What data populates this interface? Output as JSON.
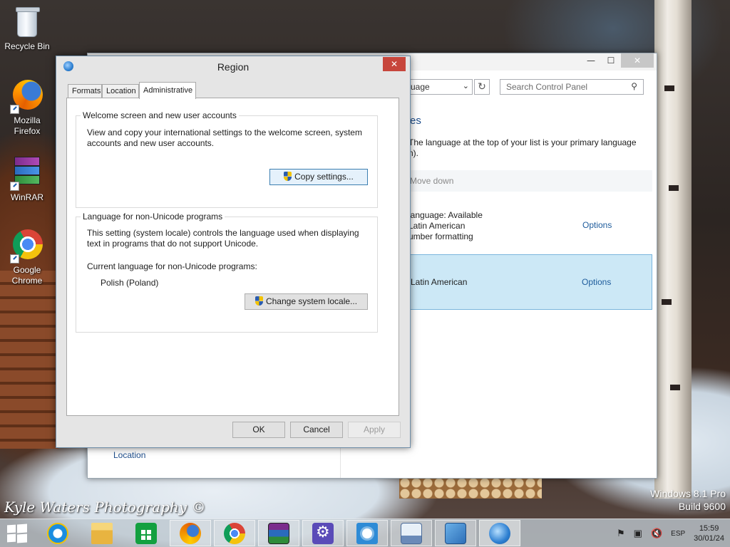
{
  "desktop": {
    "icons": [
      {
        "label": "Recycle Bin"
      },
      {
        "label": "Mozilla Firefox"
      },
      {
        "label": "WinRAR"
      },
      {
        "label": "Google Chrome"
      }
    ],
    "watermark": "Kyle Waters Photography ©",
    "os_edition": "Windows 8.1 Pro",
    "os_build": "Build 9600"
  },
  "control_panel": {
    "dropdown_value": "uage",
    "search_placeholder": "Search Control Panel",
    "heading_fragment": "es",
    "description": "The language at the top of your list is your primary language",
    "description_tail": "n).",
    "toolbar_move_down": "Move down",
    "languages": [
      {
        "line1": "language: Available",
        "line2": "Latin American",
        "line3": "umber formatting",
        "options_label": "Options"
      },
      {
        "name": "Latin American",
        "options_label": "Options",
        "selected": true
      }
    ],
    "sidebar_link": "Location",
    "window_controls": {
      "minimize": "—",
      "maximize": "☐",
      "close": "✕"
    }
  },
  "region_dialog": {
    "title": "Region",
    "close_glyph": "✕",
    "tabs": [
      {
        "label": "Formats",
        "active": false
      },
      {
        "label": "Location",
        "active": false
      },
      {
        "label": "Administrative",
        "active": true
      }
    ],
    "welcome_group": {
      "legend": "Welcome screen and new user accounts",
      "text": "View and copy your international settings to the welcome screen, system accounts and new user accounts.",
      "button": "Copy settings..."
    },
    "unicode_group": {
      "legend": "Language for non-Unicode programs",
      "text": "This setting (system locale) controls the language used when displaying text in programs that do not support Unicode.",
      "current_label": "Current language for non-Unicode programs:",
      "current_value": "Polish (Poland)",
      "button": "Change system locale..."
    },
    "footer": {
      "ok": "OK",
      "cancel": "Cancel",
      "apply": "Apply",
      "apply_enabled": false
    }
  },
  "taskbar": {
    "pinned": [
      {
        "icon": "internet-explorer-icon"
      },
      {
        "icon": "file-explorer-icon"
      },
      {
        "icon": "store-icon"
      },
      {
        "icon": "firefox-icon"
      },
      {
        "icon": "chrome-icon"
      },
      {
        "icon": "winrar-icon"
      },
      {
        "icon": "settings-icon"
      },
      {
        "icon": "weather-icon"
      },
      {
        "icon": "on-screen-keyboard-icon"
      },
      {
        "icon": "control-panel-icon"
      },
      {
        "icon": "region-icon",
        "active": true
      }
    ],
    "tray": {
      "input_language": "ESP",
      "time": "15:59",
      "date": "30/01/24"
    }
  },
  "colors": {
    "selection_bg": "#cce8f6",
    "selection_border": "#7ab5dc",
    "link": "#1e5c9c",
    "dialog_close": "#c7463c",
    "focus_border": "#3c7fb1"
  }
}
